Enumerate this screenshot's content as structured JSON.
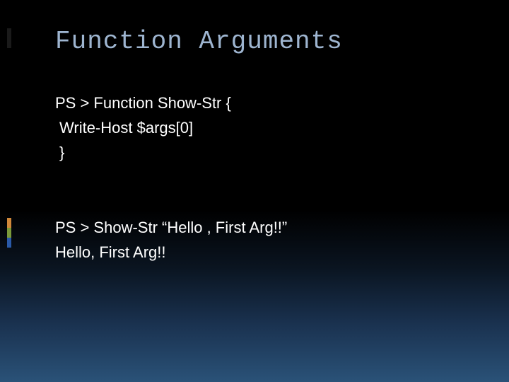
{
  "slide": {
    "title": "Function Arguments",
    "lines": {
      "l1": "PS > Function Show-Str {",
      "l2": "Write-Host $args[0]",
      "l3": "}",
      "l4": "PS > Show-Str “Hello , First Arg!!”",
      "l5": "Hello, First Arg!!"
    }
  }
}
